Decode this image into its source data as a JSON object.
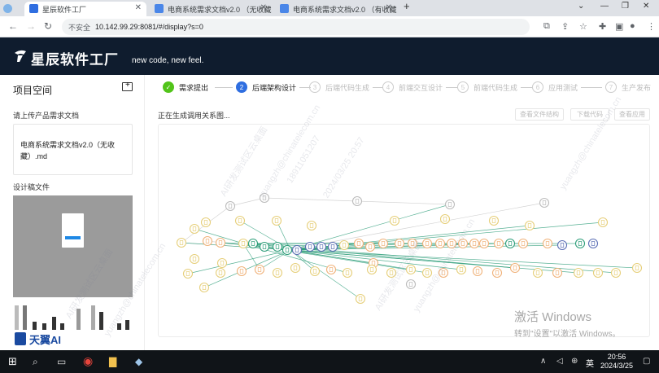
{
  "browser": {
    "tabs": [
      {
        "title": "星辰软件工厂",
        "active": true
      },
      {
        "title": "电商系统需求文档v2.0 （无收藏",
        "active": false
      },
      {
        "title": "电商系统需求文档v2.0 （有收藏",
        "active": false
      }
    ],
    "new_tab": "+",
    "address": {
      "security": "不安全",
      "url": "10.142.99.29:8081/#/display?s=0"
    }
  },
  "app": {
    "brand": "星辰软件工厂",
    "slogan": "new code, new feel."
  },
  "sidebar": {
    "title": "项目空间",
    "upload_label": "请上传产品需求文档",
    "document_name": "电商系统需求文档v2.0（无收藏）.md",
    "design_label": "设计稿文件",
    "footer_logo": "天翼AI"
  },
  "stepper": {
    "steps": [
      {
        "index": "✓",
        "label": "需求提出",
        "state": "done"
      },
      {
        "index": "2",
        "label": "后端架构设计",
        "state": "current"
      },
      {
        "index": "3",
        "label": "后端代码生成",
        "state": "pending"
      },
      {
        "index": "4",
        "label": "前端交互设计",
        "state": "pending"
      },
      {
        "index": "5",
        "label": "前端代码生成",
        "state": "pending"
      },
      {
        "index": "6",
        "label": "应用测试",
        "state": "pending"
      },
      {
        "index": "7",
        "label": "生产发布",
        "state": "pending"
      }
    ]
  },
  "main": {
    "status": "正在生成调用关系图...",
    "actions": [
      "查看文件结构",
      "下载代码",
      "查看应用"
    ]
  },
  "watermark": {
    "lines": [
      "AI研发测试区云桌面",
      "yuangzh@chinatelecom.cn",
      "18911051207",
      "2024/03/25 20:57"
    ]
  },
  "windows_notice": {
    "title": "激活 Windows",
    "subtitle": "转到\"设置\"以激活 Windows。"
  },
  "taskbar": {
    "ime": "英",
    "time": "20:56",
    "date": "2024/3/25"
  },
  "colors": {
    "header_bg": "#0f1c2e",
    "step_done": "#52c41a",
    "step_current": "#2f6ee0",
    "node_green": "#2e9e7a",
    "node_yellow": "#e6cf7a",
    "node_orange": "#f0b27a",
    "node_blue": "#5b6fb5"
  }
}
